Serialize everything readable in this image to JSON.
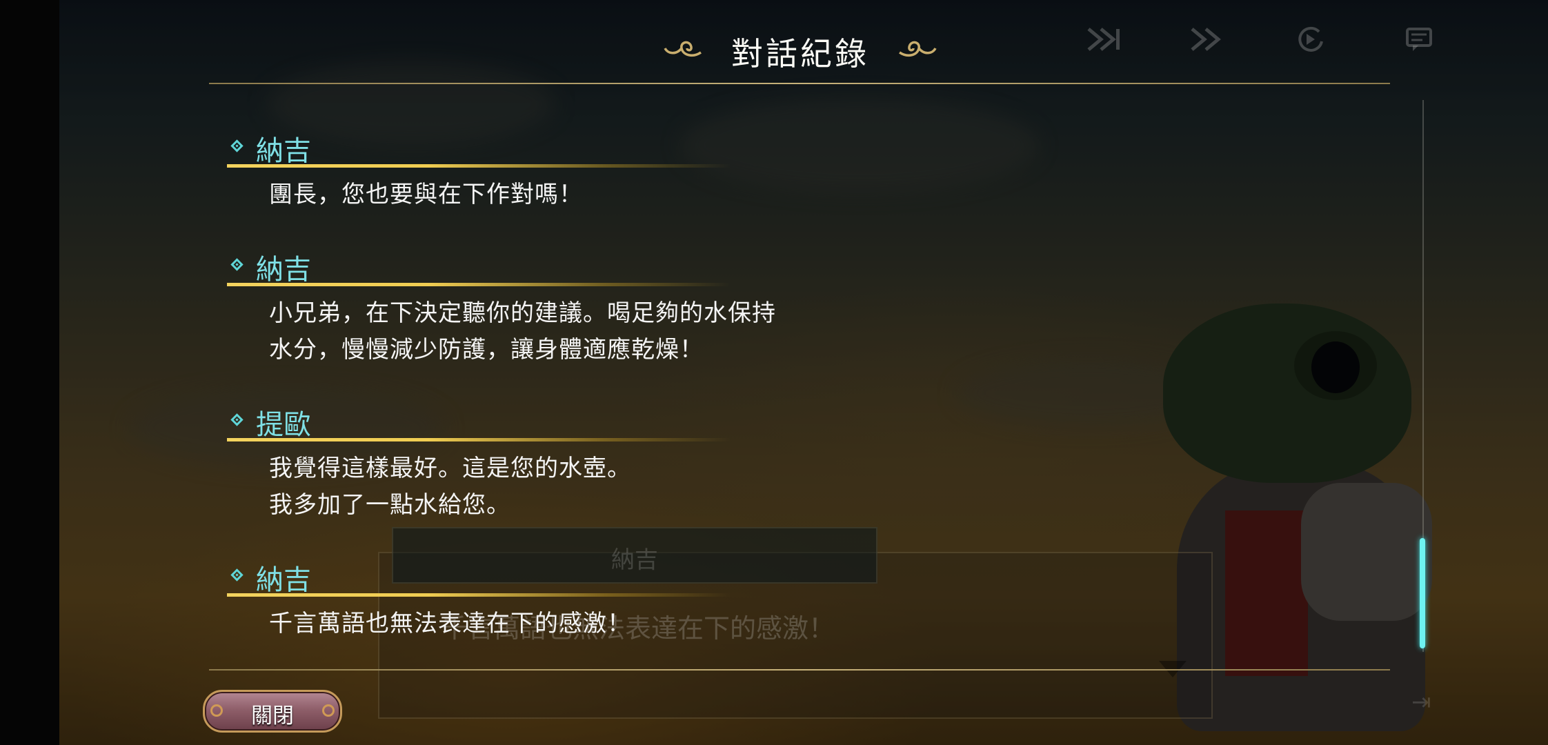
{
  "header": {
    "title": "對話紀錄"
  },
  "hud": {
    "icons": [
      "skip-icon",
      "fast-forward-icon",
      "auto-play-icon",
      "log-icon"
    ]
  },
  "log": {
    "entries": [
      {
        "speaker": "納吉",
        "lines": [
          "團長，您也要與在下作對嗎！"
        ]
      },
      {
        "speaker": "納吉",
        "lines": [
          "小兄弟，在下決定聽你的建議。喝足夠的水保持",
          "水分，慢慢減少防護，讓身體適應乾燥！"
        ]
      },
      {
        "speaker": "提歐",
        "lines": [
          "我覺得這樣最好。這是您的水壺。",
          "我多加了一點水給您。"
        ]
      },
      {
        "speaker": "納吉",
        "lines": [
          "千言萬語也無法表達在下的感激！"
        ]
      }
    ]
  },
  "background_dialog": {
    "speaker": "納吉",
    "text": "千言萬語也無法表達在下的感激！"
  },
  "footer": {
    "close_label": "關閉"
  },
  "colors": {
    "speaker_name": "#7fe0e6",
    "underline_gold": "#f0cd52",
    "scroll_thumb": "#6ef2f0",
    "divider": "#c7b27a"
  }
}
